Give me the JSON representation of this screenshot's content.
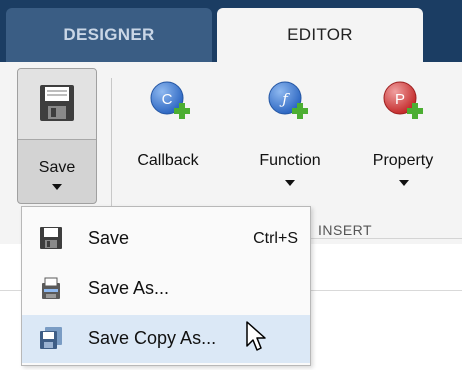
{
  "tabs": [
    {
      "label": "DESIGNER",
      "active": false
    },
    {
      "label": "EDITOR",
      "active": true
    }
  ],
  "ribbon": {
    "save": {
      "label": "Save",
      "icon": "floppy-disk-icon"
    },
    "tools": [
      {
        "label": "Callback",
        "letter": "C",
        "color": "#3f7fd6",
        "icon": "add-callback-icon"
      },
      {
        "label": "Function",
        "letter": "ƒ",
        "color": "#3f7fd6",
        "icon": "add-function-icon"
      },
      {
        "label": "Property",
        "letter": "P",
        "color": "#d63b3b",
        "icon": "add-property-icon"
      }
    ],
    "section_label": "INSERT"
  },
  "menu": {
    "items": [
      {
        "label": "Save",
        "shortcut": "Ctrl+S",
        "icon": "floppy-disk-icon"
      },
      {
        "label": "Save As...",
        "shortcut": "",
        "icon": "save-as-icon"
      },
      {
        "label": "Save Copy As...",
        "shortcut": "",
        "icon": "save-copy-icon",
        "hovered": true
      }
    ]
  },
  "colors": {
    "tabstrip": "#1b3d63",
    "ribbon": "#f4f4f4",
    "plus_green": "#4cae32",
    "menu_hover": "#dbe8f6"
  }
}
